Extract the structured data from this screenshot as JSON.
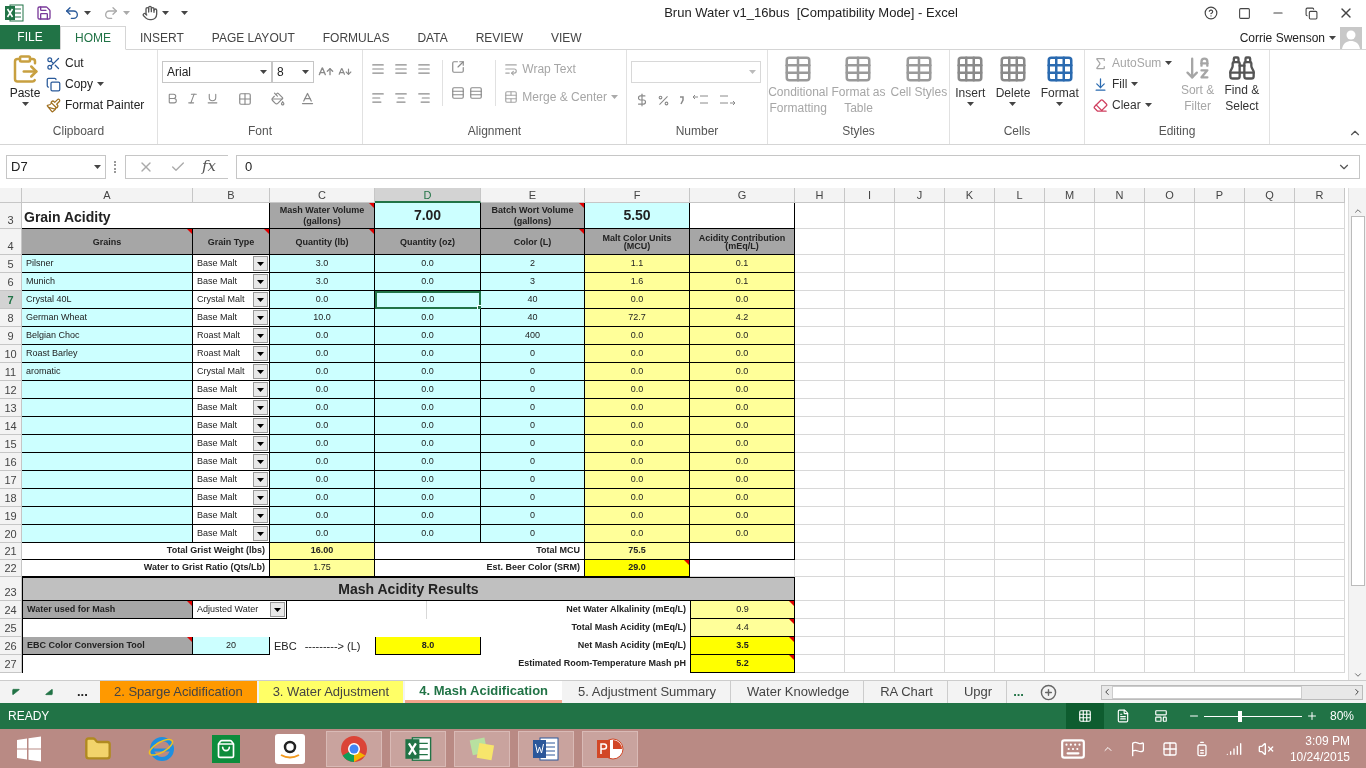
{
  "window": {
    "title": "Brun Water v1_16bus  [Compatibility Mode] - Excel",
    "user": "Corrie Swenson"
  },
  "ribbon_tabs": [
    {
      "label": "FILE",
      "selected": false,
      "kind": "file"
    },
    {
      "label": "HOME",
      "selected": true,
      "kind": "tab"
    },
    {
      "label": "INSERT",
      "selected": false,
      "kind": "tab"
    },
    {
      "label": "PAGE LAYOUT",
      "selected": false,
      "kind": "tab"
    },
    {
      "label": "FORMULAS",
      "selected": false,
      "kind": "tab"
    },
    {
      "label": "DATA",
      "selected": false,
      "kind": "tab"
    },
    {
      "label": "REVIEW",
      "selected": false,
      "kind": "tab"
    },
    {
      "label": "VIEW",
      "selected": false,
      "kind": "tab"
    }
  ],
  "ribbon": {
    "clipboard": {
      "label": "Clipboard",
      "paste": "Paste",
      "cut": "Cut",
      "copy": "Copy",
      "format_painter": "Format Painter"
    },
    "font": {
      "label": "Font",
      "name": "Arial",
      "size": "8"
    },
    "alignment": {
      "label": "Alignment",
      "wrap_text": {
        "label": "Wrap Text",
        "disabled": true
      },
      "merge": {
        "label": "Merge & Center",
        "disabled": true
      }
    },
    "number": {
      "label": "Number"
    },
    "styles": {
      "label": "Styles",
      "items": [
        {
          "label": "Conditional Formatting",
          "disabled": true
        },
        {
          "label": "Format as Table",
          "disabled": true
        },
        {
          "label": "Cell Styles",
          "disabled": true
        }
      ]
    },
    "cells": {
      "label": "Cells",
      "items": [
        {
          "label": "Insert"
        },
        {
          "label": "Delete"
        },
        {
          "label": "Format"
        }
      ]
    },
    "editing": {
      "label": "Editing",
      "autosum": {
        "label": "AutoSum",
        "disabled": true
      },
      "fill": {
        "label": "Fill",
        "disabled": false
      },
      "clear": {
        "label": "Clear",
        "disabled": false
      },
      "sort": {
        "label": "Sort & Filter",
        "disabled": true
      },
      "find": {
        "label": "Find & Select",
        "disabled": false
      }
    }
  },
  "formula_bar": {
    "name_box": "D7",
    "function_label": "fx",
    "value": "0"
  },
  "columns": [
    {
      "label": "A",
      "selected": false
    },
    {
      "label": "B",
      "selected": false
    },
    {
      "label": "C",
      "selected": false
    },
    {
      "label": "D",
      "selected": true
    },
    {
      "label": "E",
      "selected": false
    },
    {
      "label": "F",
      "selected": false
    },
    {
      "label": "G",
      "selected": false
    },
    {
      "label": "H",
      "selected": false
    },
    {
      "label": "I",
      "selected": false
    },
    {
      "label": "J",
      "selected": false
    },
    {
      "label": "K",
      "selected": false
    },
    {
      "label": "L",
      "selected": false
    },
    {
      "label": "M",
      "selected": false
    },
    {
      "label": "N",
      "selected": false
    },
    {
      "label": "O",
      "selected": false
    },
    {
      "label": "P",
      "selected": false
    },
    {
      "label": "Q",
      "selected": false
    },
    {
      "label": "R",
      "selected": false
    }
  ],
  "grain_table": {
    "title_row": "3",
    "header_row": "4",
    "title": "Grain Acidity",
    "volumes": [
      {
        "label": "Mash Water Volume    (gallons)",
        "value": "7.00",
        "note": true
      },
      {
        "label": "Batch Wort Volume (gallons)",
        "value": "5.50",
        "note": true
      }
    ],
    "headers": [
      {
        "text": "Grains",
        "note": true
      },
      {
        "text": "Grain Type",
        "note": true
      },
      {
        "text": "Quantity (lb)",
        "note": true
      },
      {
        "text": "Quantity (oz)",
        "note": false
      },
      {
        "text": "Color (L)",
        "note": true
      },
      {
        "text": "Malt Color Units (MCU)",
        "note": false
      },
      {
        "text": "Acidity Contribution (mEq/L)",
        "note": false
      }
    ],
    "rows": [
      {
        "row": "5",
        "grain": "Pilsner",
        "type": "Base Malt",
        "lb": "3.0",
        "oz": "0.0",
        "color_l": "2",
        "mcu": "1.1",
        "acidity": "0.1",
        "selected": false
      },
      {
        "row": "6",
        "grain": "Munich",
        "type": "Base Malt",
        "lb": "3.0",
        "oz": "0.0",
        "color_l": "3",
        "mcu": "1.6",
        "acidity": "0.1",
        "selected": false
      },
      {
        "row": "7",
        "grain": "Crystal 40L",
        "type": "Crystal Malt",
        "lb": "0.0",
        "oz": "0.0",
        "color_l": "40",
        "mcu": "0.0",
        "acidity": "0.0",
        "selected": true
      },
      {
        "row": "8",
        "grain": "German Wheat",
        "type": "Base Malt",
        "lb": "10.0",
        "oz": "0.0",
        "color_l": "40",
        "mcu": "72.7",
        "acidity": "4.2",
        "selected": false
      },
      {
        "row": "9",
        "grain": "Belgian Choc",
        "type": "Roast Malt",
        "lb": "0.0",
        "oz": "0.0",
        "color_l": "400",
        "mcu": "0.0",
        "acidity": "0.0",
        "selected": false
      },
      {
        "row": "10",
        "grain": "Roast Barley",
        "type": "Roast Malt",
        "lb": "0.0",
        "oz": "0.0",
        "color_l": "0",
        "mcu": "0.0",
        "acidity": "0.0",
        "selected": false
      },
      {
        "row": "11",
        "grain": "aromatic",
        "type": "Crystal Malt",
        "lb": "0.0",
        "oz": "0.0",
        "color_l": "0",
        "mcu": "0.0",
        "acidity": "0.0",
        "selected": false
      },
      {
        "row": "12",
        "type": "Base Malt",
        "lb": "0.0",
        "oz": "0.0",
        "color_l": "0",
        "mcu": "0.0",
        "acidity": "0.0",
        "selected": false
      },
      {
        "row": "13",
        "type": "Base Malt",
        "lb": "0.0",
        "oz": "0.0",
        "color_l": "0",
        "mcu": "0.0",
        "acidity": "0.0",
        "selected": false
      },
      {
        "row": "14",
        "type": "Base Malt",
        "lb": "0.0",
        "oz": "0.0",
        "color_l": "0",
        "mcu": "0.0",
        "acidity": "0.0",
        "selected": false
      },
      {
        "row": "15",
        "type": "Base Malt",
        "lb": "0.0",
        "oz": "0.0",
        "color_l": "0",
        "mcu": "0.0",
        "acidity": "0.0",
        "selected": false
      },
      {
        "row": "16",
        "type": "Base Malt",
        "lb": "0.0",
        "oz": "0.0",
        "color_l": "0",
        "mcu": "0.0",
        "acidity": "0.0",
        "selected": false
      },
      {
        "row": "17",
        "type": "Base Malt",
        "lb": "0.0",
        "oz": "0.0",
        "color_l": "0",
        "mcu": "0.0",
        "acidity": "0.0",
        "selected": false
      },
      {
        "row": "18",
        "type": "Base Malt",
        "lb": "0.0",
        "oz": "0.0",
        "color_l": "0",
        "mcu": "0.0",
        "acidity": "0.0",
        "selected": false
      },
      {
        "row": "19",
        "type": "Base Malt",
        "lb": "0.0",
        "oz": "0.0",
        "color_l": "0",
        "mcu": "0.0",
        "acidity": "0.0",
        "selected": false
      },
      {
        "row": "20",
        "type": "Base Malt",
        "lb": "0.0",
        "oz": "0.0",
        "color_l": "0",
        "mcu": "0.0",
        "acidity": "0.0",
        "selected": false
      }
    ],
    "totals": [
      {
        "row": "21",
        "label": "Total Grist Weight (lbs)",
        "value": "16.00",
        "label2": "Total MCU",
        "value2": "75.5",
        "note": false
      },
      {
        "row": "22",
        "label": "Water to Grist Ratio (Qts/Lb)",
        "value": "1.75",
        "label2": "Est. Beer Color (SRM)",
        "value2": "29.0",
        "note": true
      }
    ]
  },
  "results": {
    "title_row": "23",
    "title": "Mash Acidity Results",
    "water_label": "Water used for Mash",
    "water_value": "Adjusted Water",
    "ebc_label": "EBC Color Conversion Tool",
    "ebc_value": "20",
    "ebc_unit": "EBC",
    "ebc_arrow": "---------> (L)",
    "ebc_result": "8.0",
    "metrics": [
      {
        "row": "24",
        "label": "Net Water Alkalinity (mEq/L)",
        "value": "0.9",
        "highlight": false
      },
      {
        "row": "25",
        "label": "Total Mash Acidity (mEq/L)",
        "value": "4.4",
        "highlight": false
      },
      {
        "row": "26",
        "label": "Net Mash Acidity (mEq/L)",
        "value": "3.5",
        "highlight": true
      },
      {
        "row": "27",
        "label": "Estimated Room-Temperature Mash pH",
        "value": "5.2",
        "highlight": true
      }
    ]
  },
  "sheet_tabs": {
    "more_left": "...",
    "more_right": "...",
    "tabs": [
      {
        "label": "2. Sparge Acidification",
        "selected": false,
        "color": "#ff9900"
      },
      {
        "label": "3. Water Adjustment",
        "selected": false,
        "color": "#ffff66"
      },
      {
        "label": "4. Mash Acidification",
        "selected": true,
        "color": "#f4a48c"
      },
      {
        "label": "5. Adjustment Summary",
        "selected": false
      },
      {
        "label": "Water Knowledge",
        "selected": false
      },
      {
        "label": "RA Chart",
        "selected": false
      },
      {
        "label": "Upgr",
        "selected": false
      }
    ]
  },
  "status_bar": {
    "status": "READY",
    "zoom": "80%",
    "level": 0.37
  },
  "taskbar": {
    "time": "3:09 PM",
    "date": "10/24/2015"
  }
}
